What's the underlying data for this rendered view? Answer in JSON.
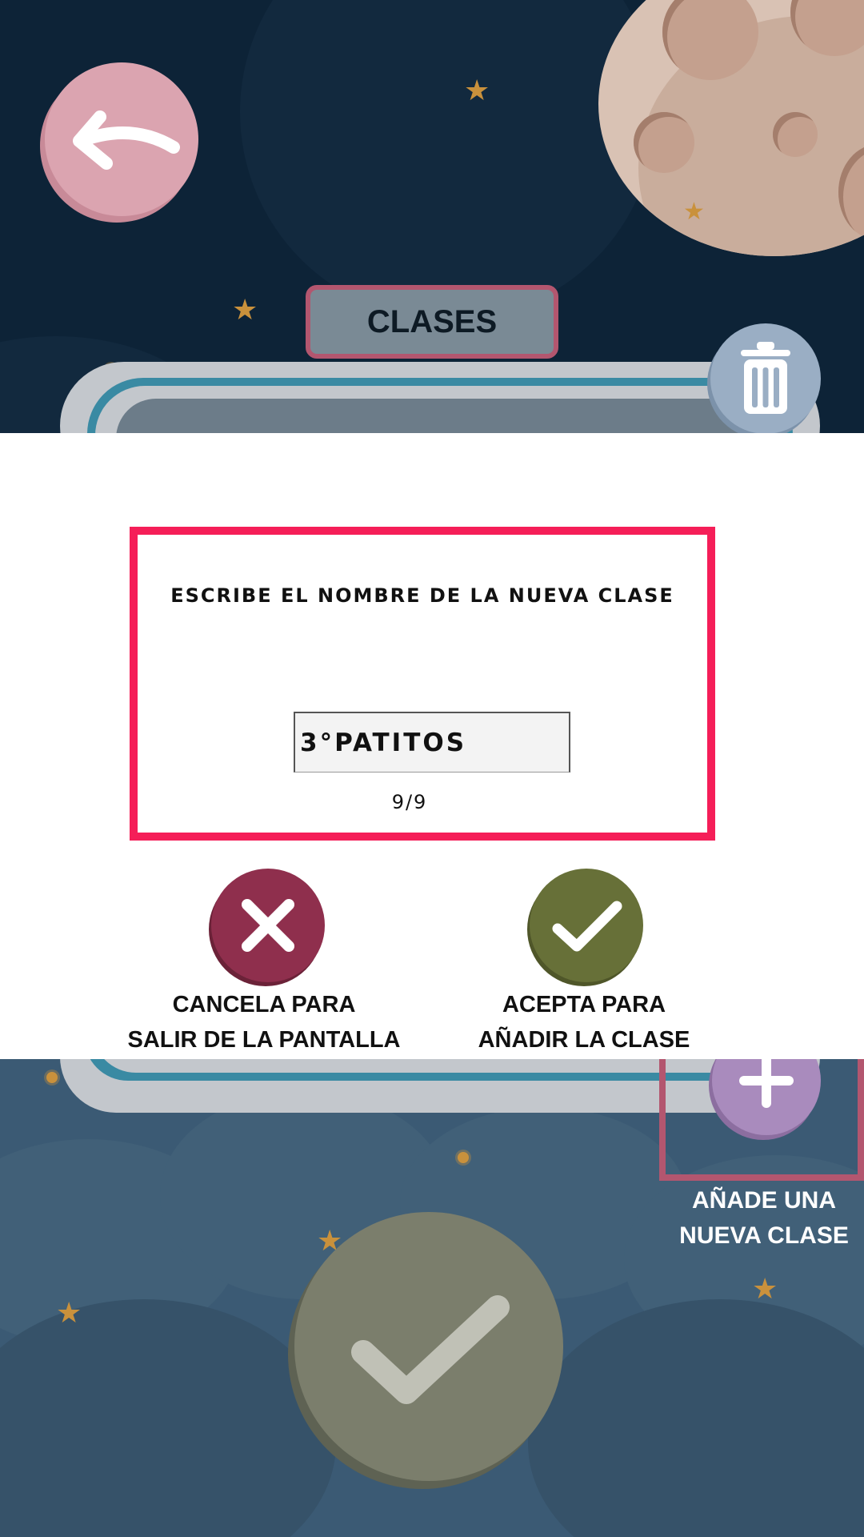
{
  "screen": {
    "title": "CLASES",
    "back_icon": "arrow-left-icon",
    "delete_icon": "trash-icon",
    "add_icon": "plus-icon",
    "add_label_line1": "AÑADE UNA",
    "add_label_line2": "NUEVA CLASE",
    "confirm_icon": "check-icon"
  },
  "dialog": {
    "prompt": "ESCRIBE EL NOMBRE DE LA NUEVA CLASE",
    "input_value": "3°PATITOS",
    "counter": "9/9",
    "cancel_icon": "close-icon",
    "accept_icon": "check-icon",
    "cancel_caption_line1": "CANCELA PARA",
    "cancel_caption_line2": "SALIR DE LA PANTALLA",
    "accept_caption_line1": "ACEPTA PARA",
    "accept_caption_line2": "AÑADIR LA CLASE"
  },
  "colors": {
    "dialog_border": "#f51e58",
    "cancel": "#8f2f4d",
    "accept": "#677038",
    "back_button": "#dba4b0",
    "add_button": "#a98bbd",
    "trash_button": "#9aaec4"
  }
}
